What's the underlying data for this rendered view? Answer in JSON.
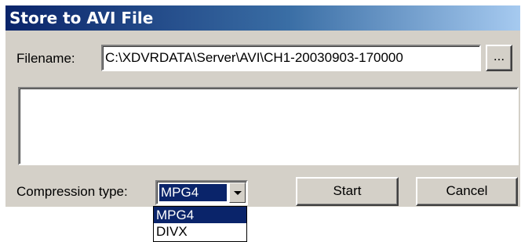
{
  "window": {
    "title": "Store to AVI File"
  },
  "filename": {
    "label": "Filename:",
    "value": "C:\\XDVRDATA\\Server\\AVI\\CH1-20030903-170000",
    "browse_label": "..."
  },
  "log": {
    "text": ""
  },
  "compression": {
    "label": "Compression type:",
    "selected": "MPG4",
    "options": [
      "MPG4",
      "DIVX"
    ]
  },
  "buttons": {
    "start": "Start",
    "cancel": "Cancel"
  },
  "colors": {
    "dialog_bg": "#d4d0c8",
    "title_start": "#0a246a",
    "title_end": "#a6caf0",
    "highlight": "#0a246a"
  }
}
